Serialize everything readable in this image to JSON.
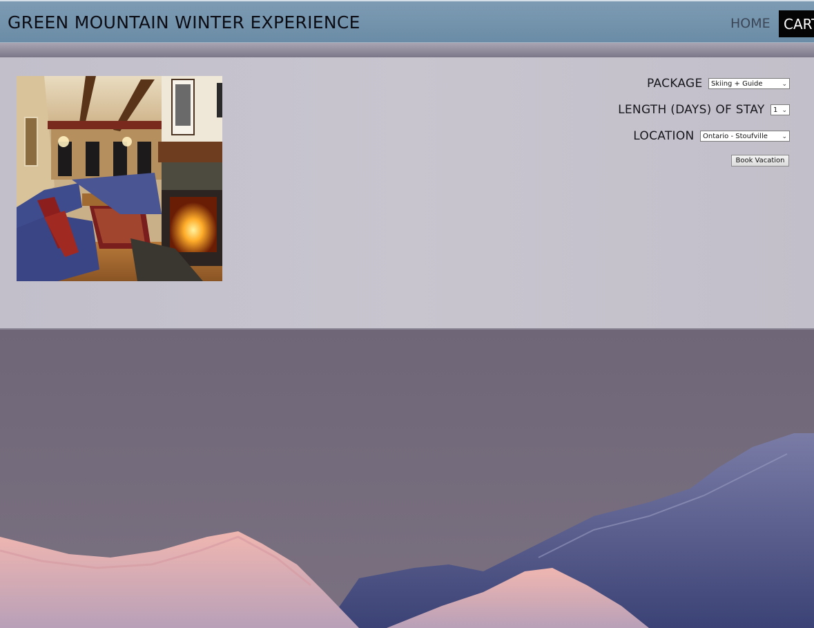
{
  "header": {
    "site_title": "GREEN MOUNTAIN WINTER EXPERIENCE",
    "nav": {
      "home": "HOME",
      "cart": "CART"
    }
  },
  "booking_form": {
    "package": {
      "label": "PACKAGE",
      "selected": "Skiing + Guide"
    },
    "length": {
      "label": "LENGTH (DAYS) OF STAY",
      "selected": "1"
    },
    "location": {
      "label": "LOCATION",
      "selected": "Ontario - Stoufville"
    },
    "submit_label": "Book Vacation"
  },
  "icons": {
    "select_chevron": "chevron-down-icon"
  },
  "colors": {
    "header_bg": "#6b8ca6",
    "panel_bg": "#c5c2cc",
    "cart_bg": "#050505"
  }
}
